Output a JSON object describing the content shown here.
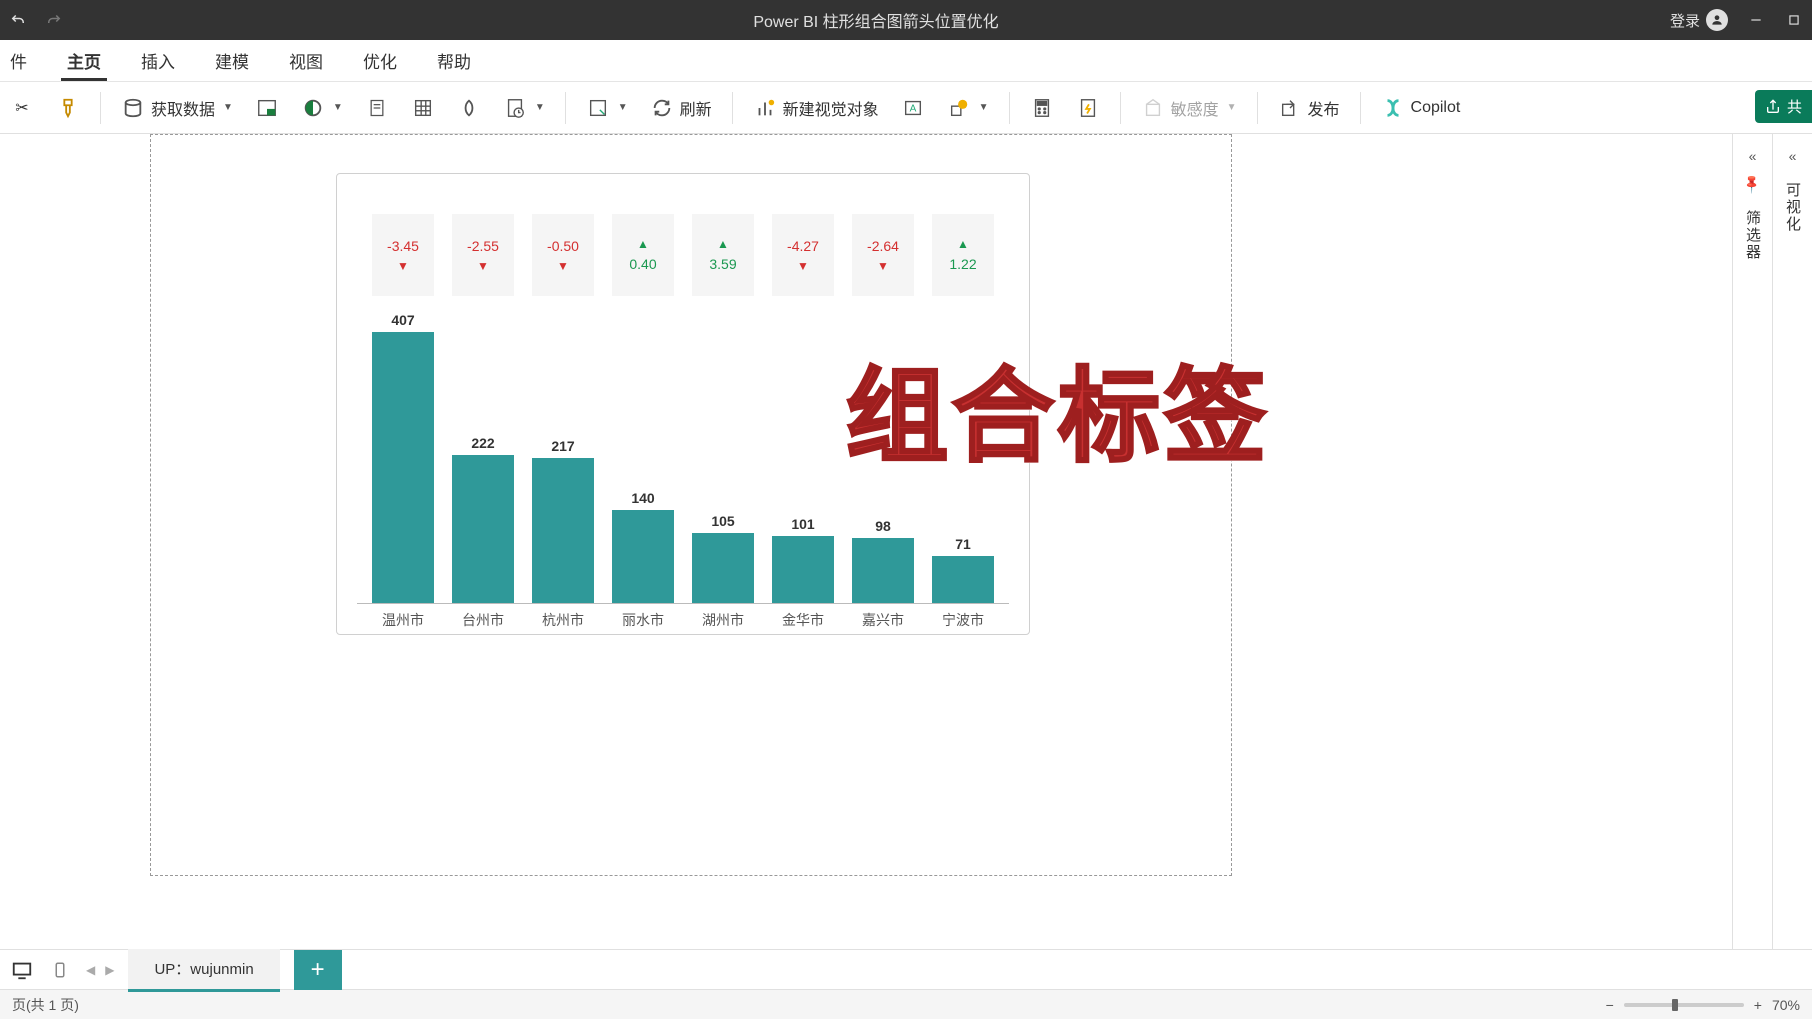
{
  "app": {
    "title": "Power BI 柱形组合图箭头位置优化",
    "sign_in": "登录"
  },
  "tabs": {
    "file": "件",
    "home": "主页",
    "insert": "插入",
    "model": "建模",
    "view": "视图",
    "optimize": "优化",
    "help": "帮助"
  },
  "toolbar": {
    "get_data": "获取数据",
    "refresh": "刷新",
    "new_visual": "新建视觉对象",
    "sensitivity": "敏感度",
    "publish": "发布",
    "copilot": "Copilot",
    "share": "共"
  },
  "overlay": "组合标签",
  "chart_data": {
    "type": "bar",
    "categories": [
      "温州市",
      "台州市",
      "杭州市",
      "丽水市",
      "湖州市",
      "金华市",
      "嘉兴市",
      "宁波市"
    ],
    "values": [
      407,
      222,
      217,
      140,
      105,
      101,
      98,
      71
    ],
    "deltas": [
      -3.45,
      -2.55,
      -0.5,
      0.4,
      3.59,
      -4.27,
      -2.64,
      1.22
    ],
    "bar_color": "#2f9999",
    "pos_color": "#1a9850",
    "neg_color": "#d43030",
    "ylim": [
      0,
      420
    ]
  },
  "panes": {
    "filter": "筛选器",
    "visualize": "可视化"
  },
  "pages": {
    "active": "UP：wujunmin",
    "status": "页(共 1 页)"
  },
  "zoom": {
    "level": "70%"
  }
}
